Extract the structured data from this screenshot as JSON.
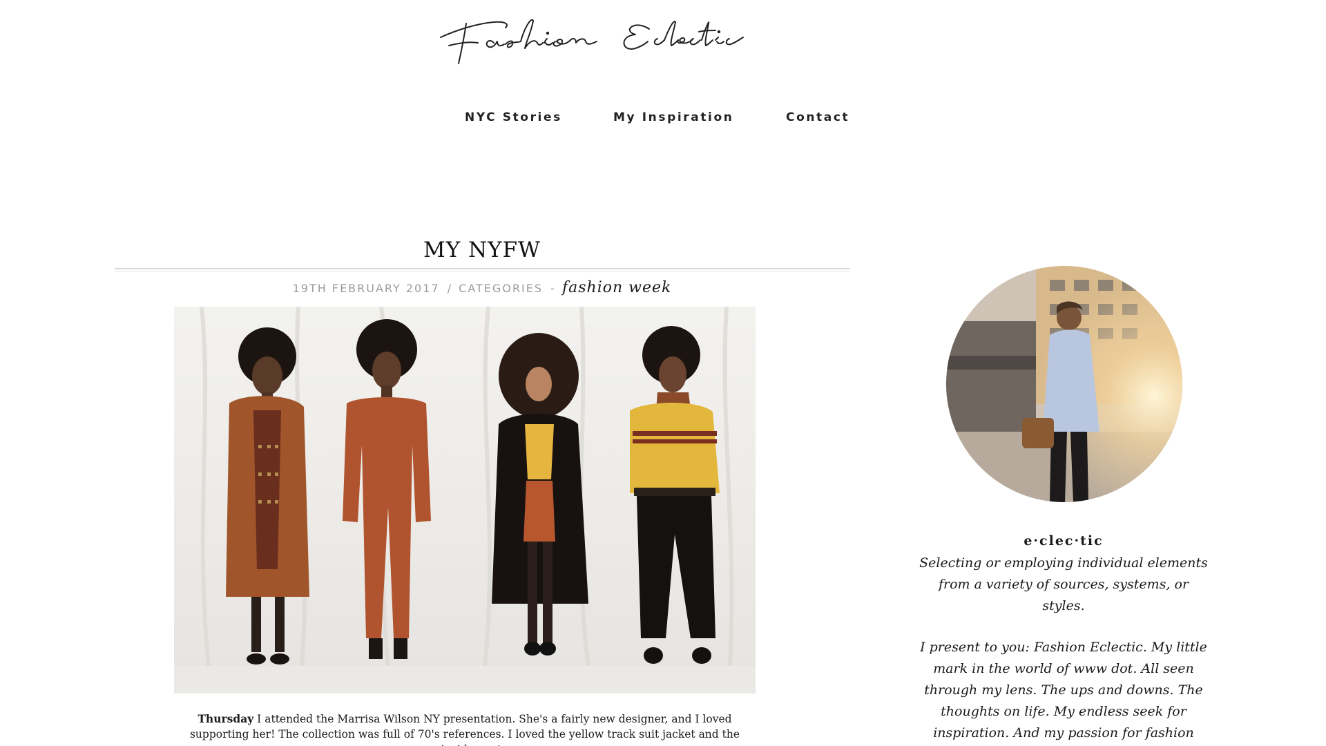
{
  "site": {
    "logo_text": "Fashion Eclectic"
  },
  "nav": {
    "items": [
      {
        "label": "NYC Stories"
      },
      {
        "label": "My Inspiration"
      },
      {
        "label": "Contact"
      }
    ]
  },
  "post": {
    "title": "MY NYFW",
    "date": "19TH FEBRUARY 2017",
    "meta_sep": "/",
    "categories_label": "CATEGORIES",
    "cat_dash": "-",
    "category": "fashion week",
    "body_bold": "Thursday",
    "body_text": " I attended the Marrisa Wilson NY presentation. She's a fairly new designer, and I loved supporting her! The collection was full of 70's references. I loved the yellow track suit jacket and the semi-wide pants."
  },
  "sidebar": {
    "word": "e·clec·tic",
    "definition": "Selecting or employing individual elements from a variety of sources, systems, or styles.",
    "intro": "I present to you: Fashion Eclectic. My little mark in the world of www dot. All seen through my lens. The ups and downs. The thoughts on life. My endless seek for inspiration. And my passion for fashion writing. This is"
  },
  "colors": {
    "text": "#1a1a1a",
    "meta_grey": "#9a9a9a",
    "rule": "#d8d8d8"
  }
}
